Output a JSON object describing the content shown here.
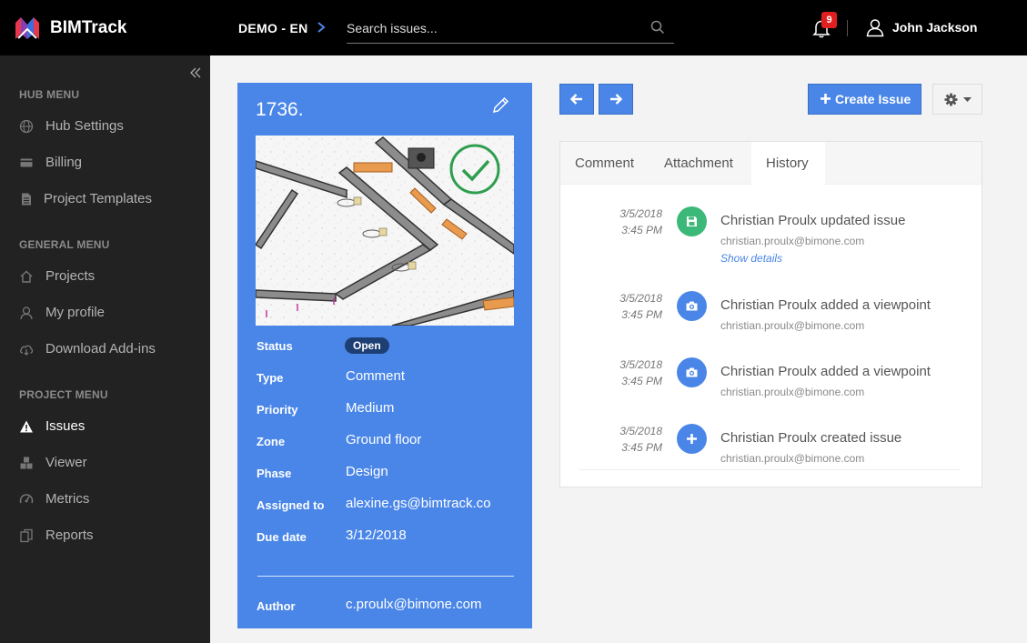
{
  "app": {
    "name": "BIMTrack",
    "project": "DEMO - EN"
  },
  "search": {
    "placeholder": "Search issues..."
  },
  "notifications": {
    "count": "9"
  },
  "user": {
    "name": "John Jackson"
  },
  "sidebar": {
    "sections": [
      {
        "title": "HUB MENU",
        "items": [
          "Hub Settings",
          "Billing",
          "Project Templates"
        ]
      },
      {
        "title": "GENERAL MENU",
        "items": [
          "Projects",
          "My profile",
          "Download Add-ins"
        ]
      },
      {
        "title": "PROJECT MENU",
        "items": [
          "Issues",
          "Viewer",
          "Metrics",
          "Reports"
        ]
      }
    ],
    "active_item": "Issues"
  },
  "issue": {
    "number": "1736.",
    "fields": [
      {
        "label": "Status",
        "value": "Open"
      },
      {
        "label": "Type",
        "value": "Comment"
      },
      {
        "label": "Priority",
        "value": "Medium"
      },
      {
        "label": "Zone",
        "value": "Ground floor"
      },
      {
        "label": "Phase",
        "value": "Design"
      },
      {
        "label": "Assigned to",
        "value": "alexine.gs@bimtrack.co"
      },
      {
        "label": "Due date",
        "value": "3/12/2018"
      },
      {
        "label": "Author",
        "value": "c.proulx@bimone.com"
      }
    ]
  },
  "toolbar": {
    "create_label": "Create Issue"
  },
  "tabs": [
    "Comment",
    "Attachment",
    "History"
  ],
  "active_tab": "History",
  "history": [
    {
      "date": "3/5/2018",
      "time": "3:45 PM",
      "text": "Christian Proulx updated issue",
      "email": "christian.proulx@bimone.com",
      "link": "Show details",
      "icon": "save-icon",
      "color": "#3cb878"
    },
    {
      "date": "3/5/2018",
      "time": "3:45 PM",
      "text": "Christian Proulx added a viewpoint",
      "email": "christian.proulx@bimone.com",
      "icon": "camera-icon",
      "color": "#4a86e8"
    },
    {
      "date": "3/5/2018",
      "time": "3:45 PM",
      "text": "Christian Proulx added a viewpoint",
      "email": "christian.proulx@bimone.com",
      "icon": "camera-icon",
      "color": "#4a86e8"
    },
    {
      "date": "3/5/2018",
      "time": "3:45 PM",
      "text": "Christian Proulx created issue",
      "email": "christian.proulx@bimone.com",
      "icon": "plus-icon",
      "color": "#4a86e8"
    }
  ],
  "colors": {
    "accent": "#4a86e8",
    "success": "#3cb878",
    "topbar": "#000000",
    "sidebar": "#222222",
    "badge": "#e02020"
  }
}
